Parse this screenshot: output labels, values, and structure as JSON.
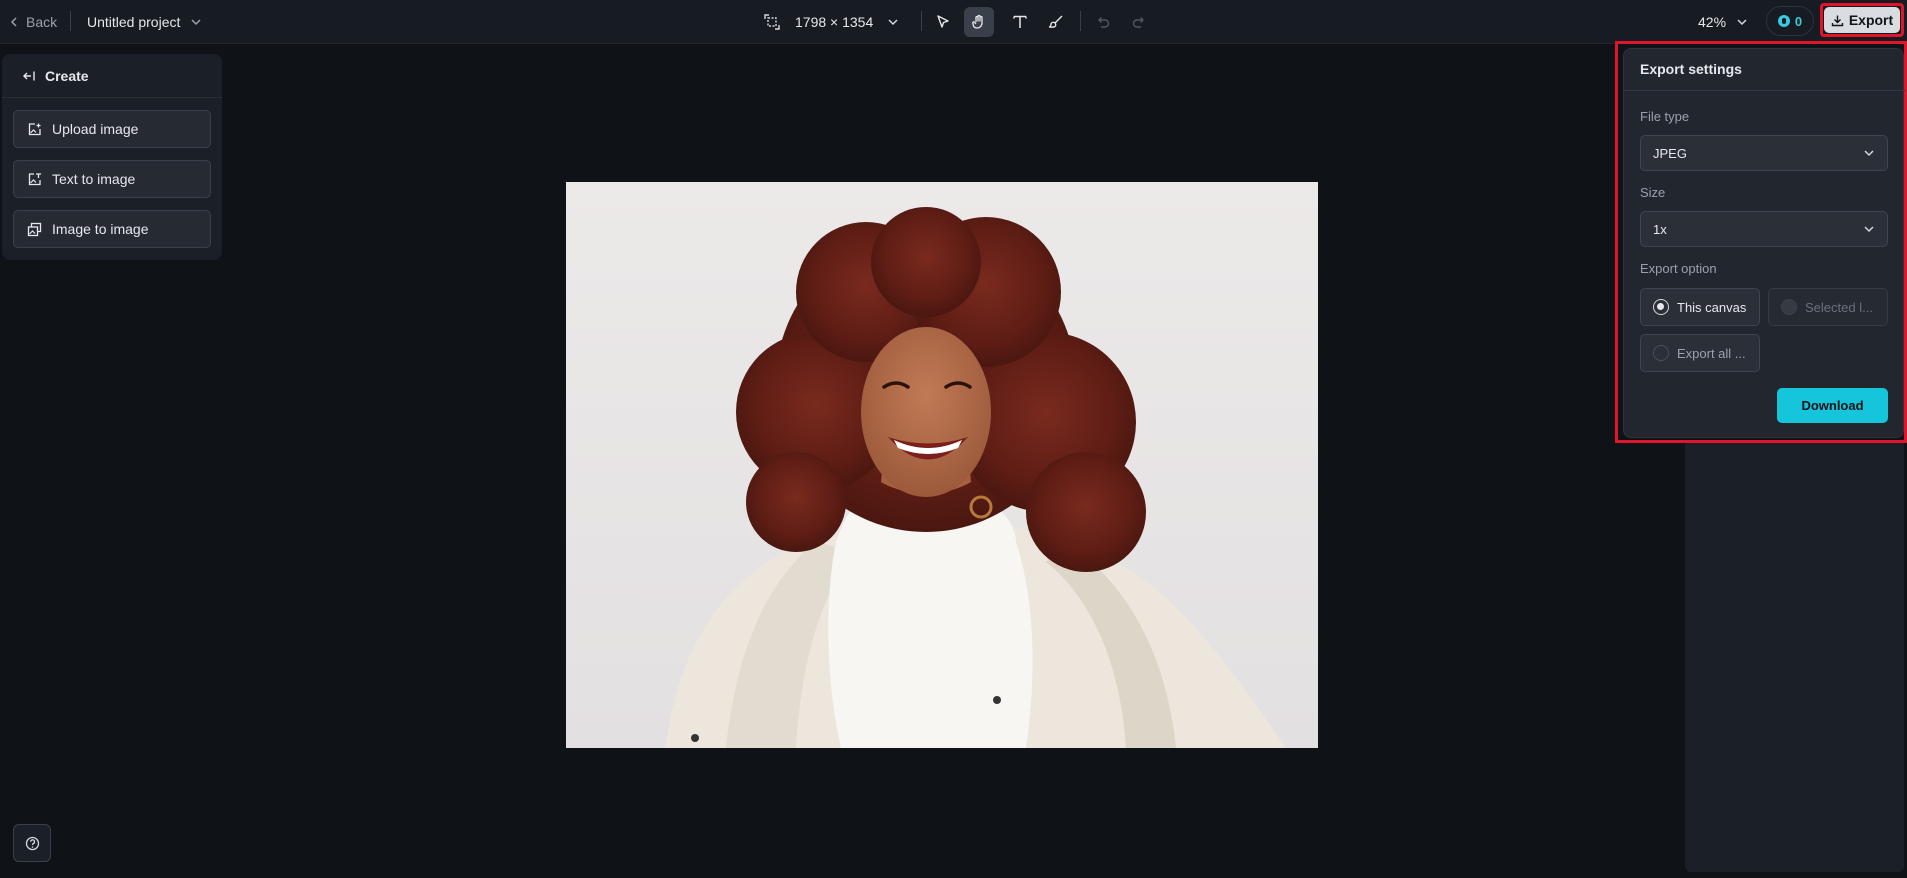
{
  "topbar": {
    "back_label": "Back",
    "project_name": "Untitled project",
    "canvas_size": "1798 × 1354",
    "tools": [
      "select-tool",
      "hand-tool",
      "text-tool",
      "brush-tool",
      "undo",
      "redo"
    ],
    "zoom": "42%",
    "credits": "0",
    "export_label": "Export"
  },
  "create_panel": {
    "title": "Create",
    "items": [
      {
        "label": "Upload image",
        "icon": "upload-image-icon"
      },
      {
        "label": "Text to image",
        "icon": "text-to-image-icon"
      },
      {
        "label": "Image to image",
        "icon": "image-to-image-icon"
      }
    ]
  },
  "export_settings": {
    "title": "Export settings",
    "file_type_label": "File type",
    "file_type_value": "JPEG",
    "size_label": "Size",
    "size_value": "1x",
    "export_option_label": "Export option",
    "options": [
      {
        "label": "This canvas",
        "selected": true,
        "disabled": false
      },
      {
        "label": "Selected l...",
        "selected": false,
        "disabled": true
      },
      {
        "label": "Export all ...",
        "selected": false,
        "disabled": false
      }
    ],
    "download_label": "Download"
  },
  "colors": {
    "accent": "#15c5dc",
    "highlight_border": "#e0142b",
    "background": "#0f1217"
  }
}
